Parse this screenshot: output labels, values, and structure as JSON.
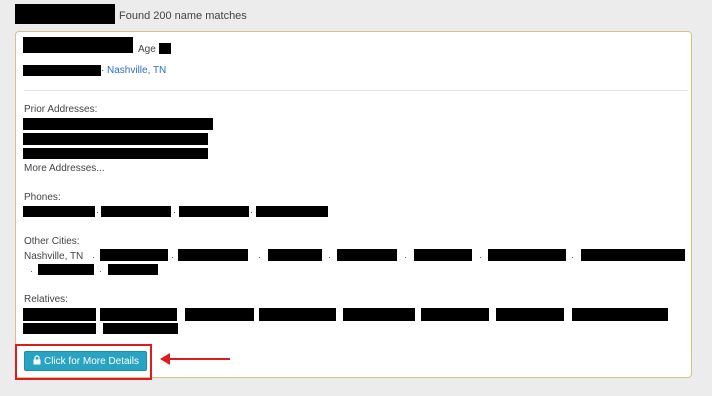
{
  "header": {
    "results_text": "Found 200 name matches"
  },
  "person": {
    "age_label": "Age",
    "location": "Nashville, TN",
    "location_separator": "·"
  },
  "sections": {
    "prior_addresses_label": "Prior Addresses:",
    "more_addresses_link": "More Addresses...",
    "phones_label": "Phones:",
    "other_cities_label": "Other Cities:",
    "other_cities_first": "Nashville, TN",
    "relatives_label": "Relatives:"
  },
  "button": {
    "label": "Click for More Details",
    "icon": "lock-icon"
  },
  "colors": {
    "button_bg": "#29a3c2",
    "card_border": "#d9c18e",
    "annotation": "#e01b1b",
    "link": "#2a6fc7"
  }
}
